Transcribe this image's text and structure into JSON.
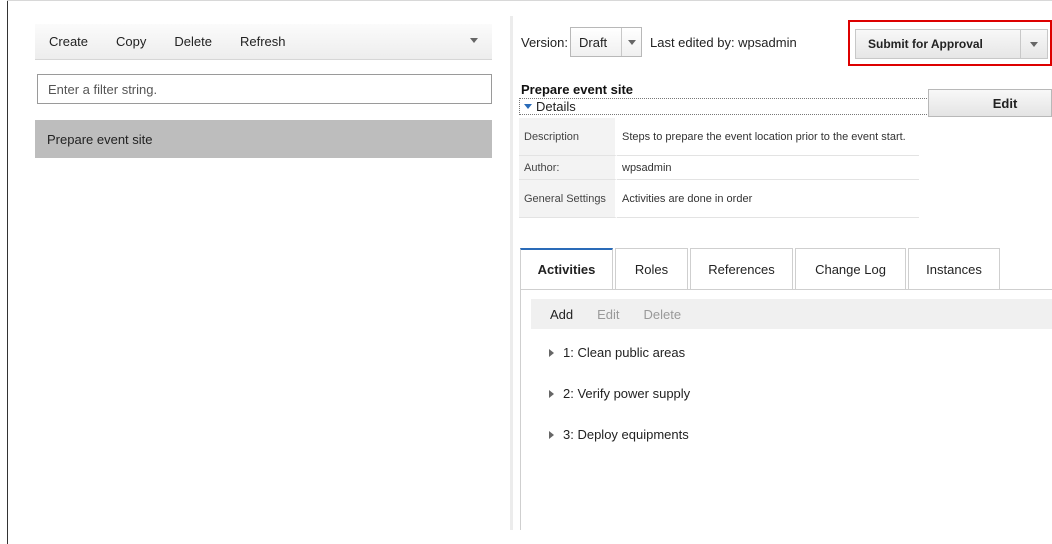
{
  "toolbar": {
    "create": "Create",
    "copy": "Copy",
    "delete": "Delete",
    "refresh": "Refresh"
  },
  "filter": {
    "placeholder": "Enter a filter string."
  },
  "list": {
    "selected_item": "Prepare event site"
  },
  "header": {
    "version_label": "Version:",
    "version_value": "Draft",
    "last_edited": "Last edited by: wpsadmin",
    "submit_label": "Submit for Approval"
  },
  "details": {
    "title": "Prepare event site",
    "section_label": "Details",
    "edit_label": "Edit",
    "rows": [
      {
        "key": "Description",
        "value": "Steps to prepare the event location prior to the event start."
      },
      {
        "key": "Author:",
        "value": "wpsadmin"
      },
      {
        "key": "General Settings",
        "value": "Activities are done in order"
      }
    ]
  },
  "tabs": [
    "Activities",
    "Roles",
    "References",
    "Change Log",
    "Instances"
  ],
  "activities": {
    "toolbar": {
      "add": "Add",
      "edit": "Edit",
      "delete": "Delete"
    },
    "items": [
      "1: Clean public areas",
      "2: Verify power supply",
      "3: Deploy equipments"
    ]
  },
  "colors": {
    "accent": "#2a6bb8",
    "highlight_border": "#dd0000",
    "selected_row": "#bdbdbd"
  }
}
